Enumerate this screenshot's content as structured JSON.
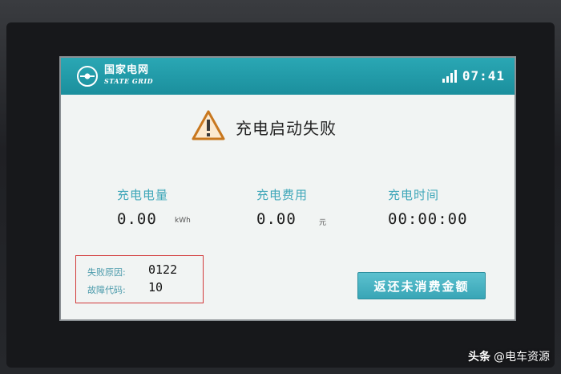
{
  "header": {
    "brand_cn": "国家电网",
    "brand_en": "STATE GRID",
    "logo_icon": "state-grid-logo-icon",
    "signal_icon": "signal-bars-icon",
    "time": "07:41"
  },
  "alert": {
    "icon": "warning-triangle-icon",
    "title": "充电启动失败"
  },
  "metrics": [
    {
      "label": "充电电量",
      "value": "0.00",
      "unit": "kWh"
    },
    {
      "label": "充电费用",
      "value": "0.00",
      "unit": "元"
    },
    {
      "label": "充电时间",
      "value": "00:00:00",
      "unit": ""
    }
  ],
  "failure": {
    "reason_label": "失败原因:",
    "reason_value": "0122",
    "code_label": "故障代码:",
    "code_value": "10"
  },
  "refund_button": {
    "label": "返还未消费金额"
  },
  "watermark": {
    "brand": "头条",
    "handle": "@电车资源"
  },
  "colors": {
    "header": "#1b8f9d",
    "accent_label": "#3fa7b9",
    "button": "#38a5b6",
    "warning": "#c8771e",
    "highlight_box": "#d23a3a"
  }
}
